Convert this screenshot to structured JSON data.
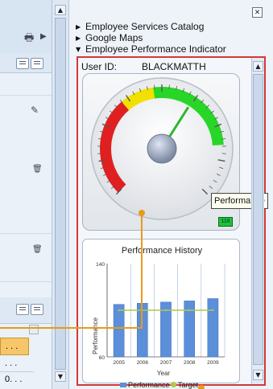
{
  "side_panel": {
    "close_label": "✕",
    "catalog_items": [
      {
        "label": "Employee Services Catalog",
        "expanded": false
      },
      {
        "label": "Google Maps",
        "expanded": false
      },
      {
        "label": "Employee Performance Indicator",
        "expanded": true
      }
    ]
  },
  "widget": {
    "user_id_label": "User ID:",
    "user_id_value": "BLACKMATTH",
    "gauge": {
      "value_badge": "116",
      "tooltip": "Performance",
      "needle_fraction": 0.62,
      "colors": {
        "low": "#e02020",
        "mid": "#f2e000",
        "high": "#28d628"
      }
    }
  },
  "chart_data": {
    "type": "bar",
    "title": "Performance History",
    "xlabel": "Year",
    "ylabel": "Performance",
    "categories": [
      "2005",
      "2006",
      "2007",
      "2008",
      "2009"
    ],
    "series": [
      {
        "name": "Performance",
        "values": [
          105,
          106,
          107,
          108,
          110
        ],
        "color": "#5b8fd9"
      },
      {
        "name": "Target",
        "values": [
          100,
          100,
          100,
          100,
          100
        ],
        "color": "#b2c64a"
      }
    ],
    "ylim": [
      60,
      140
    ],
    "yticks": [
      "140",
      "60"
    ],
    "grid": "vertical"
  },
  "left_panel": {
    "truncated_cells": [
      ". . .",
      ". . .",
      "0. . ."
    ]
  }
}
